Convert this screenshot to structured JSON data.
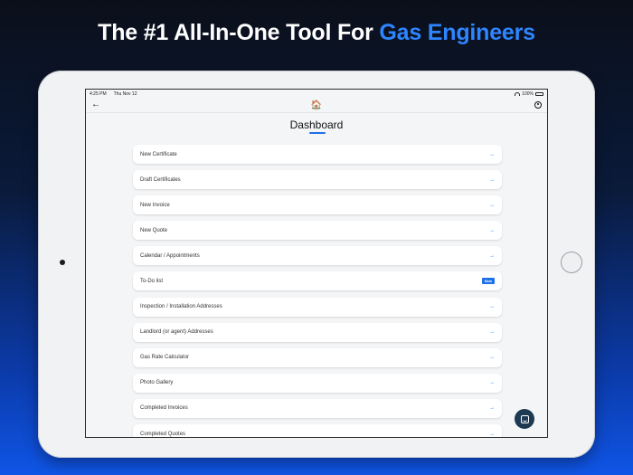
{
  "headline": {
    "prefix": "The #1 All-In-One Tool For ",
    "accent": "Gas Engineers"
  },
  "status": {
    "time": "4:25 PM",
    "date": "Thu Nov 12",
    "battery": "100%"
  },
  "nav": {
    "back_icon": "←",
    "home_icon": "🏠"
  },
  "page": {
    "title": "Dashboard"
  },
  "menu": {
    "arrow": "→",
    "badge": "New",
    "items": [
      {
        "label": "New Certificate"
      },
      {
        "label": "Draft Certificates"
      },
      {
        "label": "New Invoice"
      },
      {
        "label": "New Quote"
      },
      {
        "label": "Calendar / Appointments"
      },
      {
        "label": "To-Do list"
      },
      {
        "label": "Inspection / Installation Addresses"
      },
      {
        "label": "Landlord (or agent) Addresses"
      },
      {
        "label": "Gas Rate Calculator"
      },
      {
        "label": "Photo Gallery"
      },
      {
        "label": "Completed Invoices"
      },
      {
        "label": "Completed Quotes"
      }
    ]
  },
  "colors": {
    "accent": "#1f6fe8",
    "headline_accent": "#2e86ff",
    "fab": "#1d3a52"
  }
}
